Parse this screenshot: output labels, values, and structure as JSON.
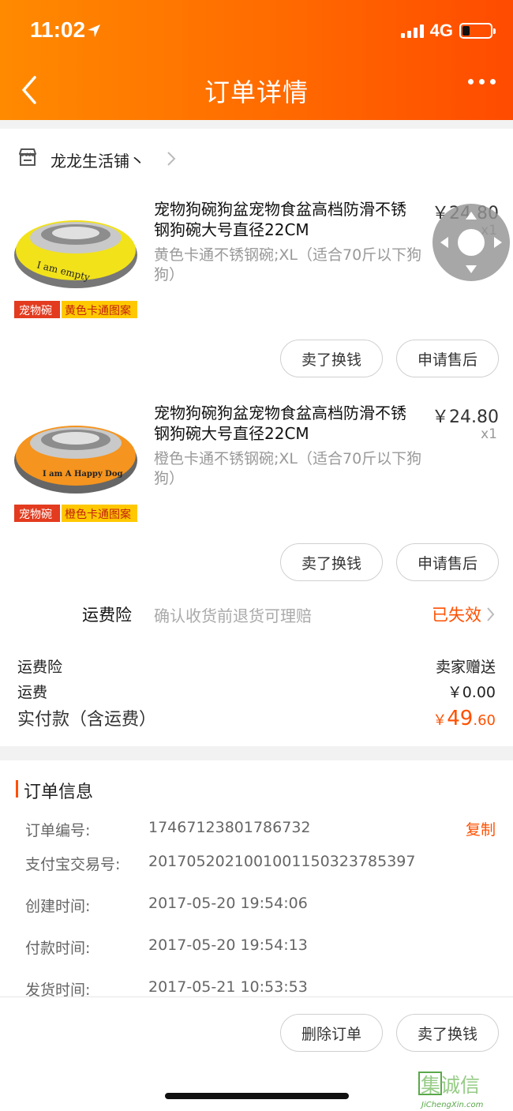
{
  "status": {
    "time": "11:02",
    "network": "4G"
  },
  "nav": {
    "title": "订单详情"
  },
  "shop": {
    "name": "龙龙生活铺丶"
  },
  "items": [
    {
      "title": "宠物狗碗狗盆宠物食盆高档防滑不锈钢狗碗大号直径22CM",
      "sku": "黄色卡通不锈钢碗;XL（适合70斤以下狗狗）",
      "price": "￥24.80",
      "qty": "x1",
      "image_tag": "宠物碗",
      "image_caption": "黄色卡通图案",
      "image_text": "I am empty",
      "sell_button": "卖了换钱",
      "aftersale_button": "申请售后"
    },
    {
      "title": "宠物狗碗狗盆宠物食盆高档防滑不锈钢狗碗大号直径22CM",
      "sku": "橙色卡通不锈钢碗;XL（适合70斤以下狗狗）",
      "price": "￥24.80",
      "qty": "x1",
      "image_tag": "宠物碗",
      "image_caption": "橙色卡通图案",
      "image_text": "I am A Happy Dog",
      "sell_button": "卖了换钱",
      "aftersale_button": "申请售后"
    }
  ],
  "insurance": {
    "label": "运费险",
    "desc": "确认收货前退货可理赔",
    "status": "已失效"
  },
  "summary": {
    "rows": [
      {
        "label": "运费险",
        "value": "卖家赠送"
      },
      {
        "label": "运费",
        "value": "￥0.00"
      }
    ],
    "total_label": "实付款（含运费）",
    "total_currency": "￥",
    "total_int": "49",
    "total_dec": ".60"
  },
  "order_info": {
    "title": "订单信息",
    "copy_label": "复制",
    "rows": [
      {
        "label": "订单编号:",
        "value": "17467123801786732"
      },
      {
        "label": "支付宝交易号:",
        "value": "2017052021001001150323785397"
      },
      {
        "label": "创建时间:",
        "value": "2017-05-20 19:54:06"
      },
      {
        "label": "付款时间:",
        "value": "2017-05-20 19:54:13"
      },
      {
        "label": "发货时间:",
        "value": "2017-05-21 10:53:53"
      }
    ]
  },
  "bottom": {
    "delete_button": "删除订单",
    "sell_button": "卖了换钱"
  },
  "watermark": {
    "glyphs": "集诚信",
    "url": "JiChengXin.com"
  },
  "colors": {
    "accent": "#ff5000",
    "header_start": "#ff8a00",
    "header_end": "#ff4b00"
  }
}
